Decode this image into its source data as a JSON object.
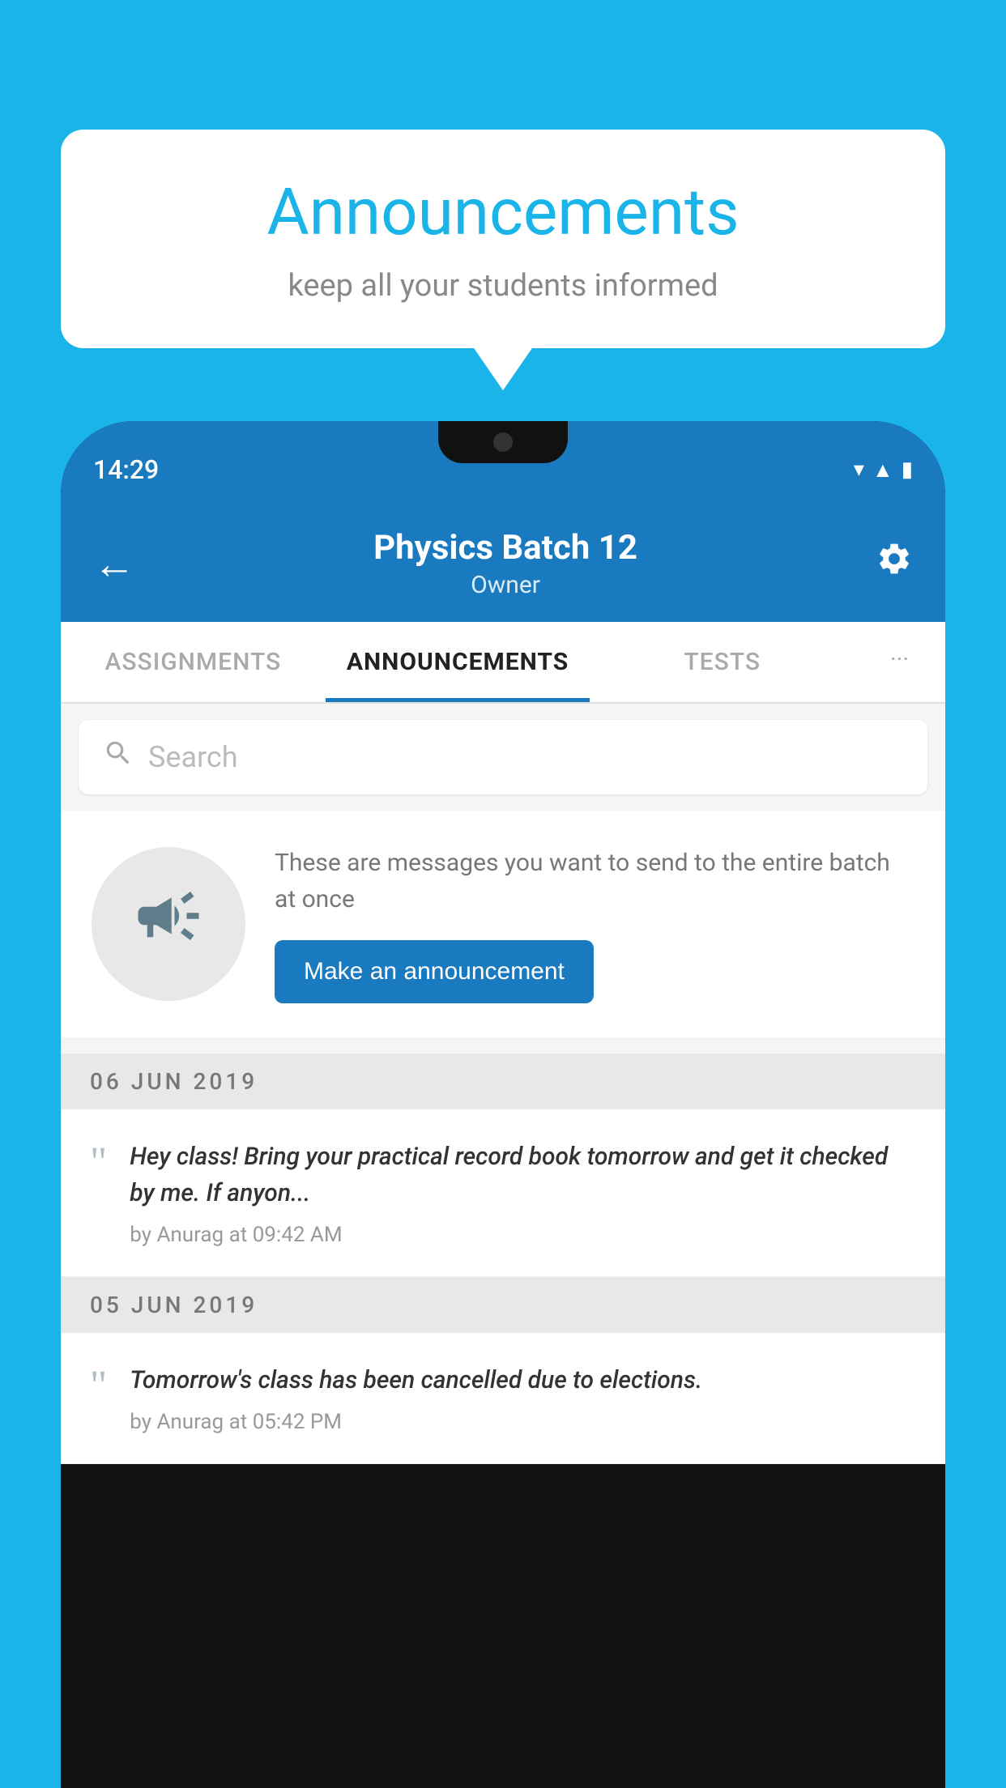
{
  "bubble": {
    "title": "Announcements",
    "subtitle": "keep all your students informed"
  },
  "phone": {
    "status_time": "14:29"
  },
  "header": {
    "title": "Physics Batch 12",
    "subtitle": "Owner",
    "back_label": "←",
    "settings_label": "⚙"
  },
  "tabs": [
    {
      "label": "ASSIGNMENTS",
      "active": false
    },
    {
      "label": "ANNOUNCEMENTS",
      "active": true
    },
    {
      "label": "TESTS",
      "active": false
    },
    {
      "label": "···",
      "active": false
    }
  ],
  "search": {
    "placeholder": "Search"
  },
  "prompt": {
    "text": "These are messages you want to send to the entire batch at once",
    "button_label": "Make an announcement"
  },
  "announcements": [
    {
      "date": "06  JUN  2019",
      "message": "Hey class! Bring your practical record book tomorrow and get it checked by me. If anyon...",
      "meta": "by Anurag at 09:42 AM"
    },
    {
      "date": "05  JUN  2019",
      "message": "Tomorrow's class has been cancelled due to elections.",
      "meta": "by Anurag at 05:42 PM"
    }
  ]
}
